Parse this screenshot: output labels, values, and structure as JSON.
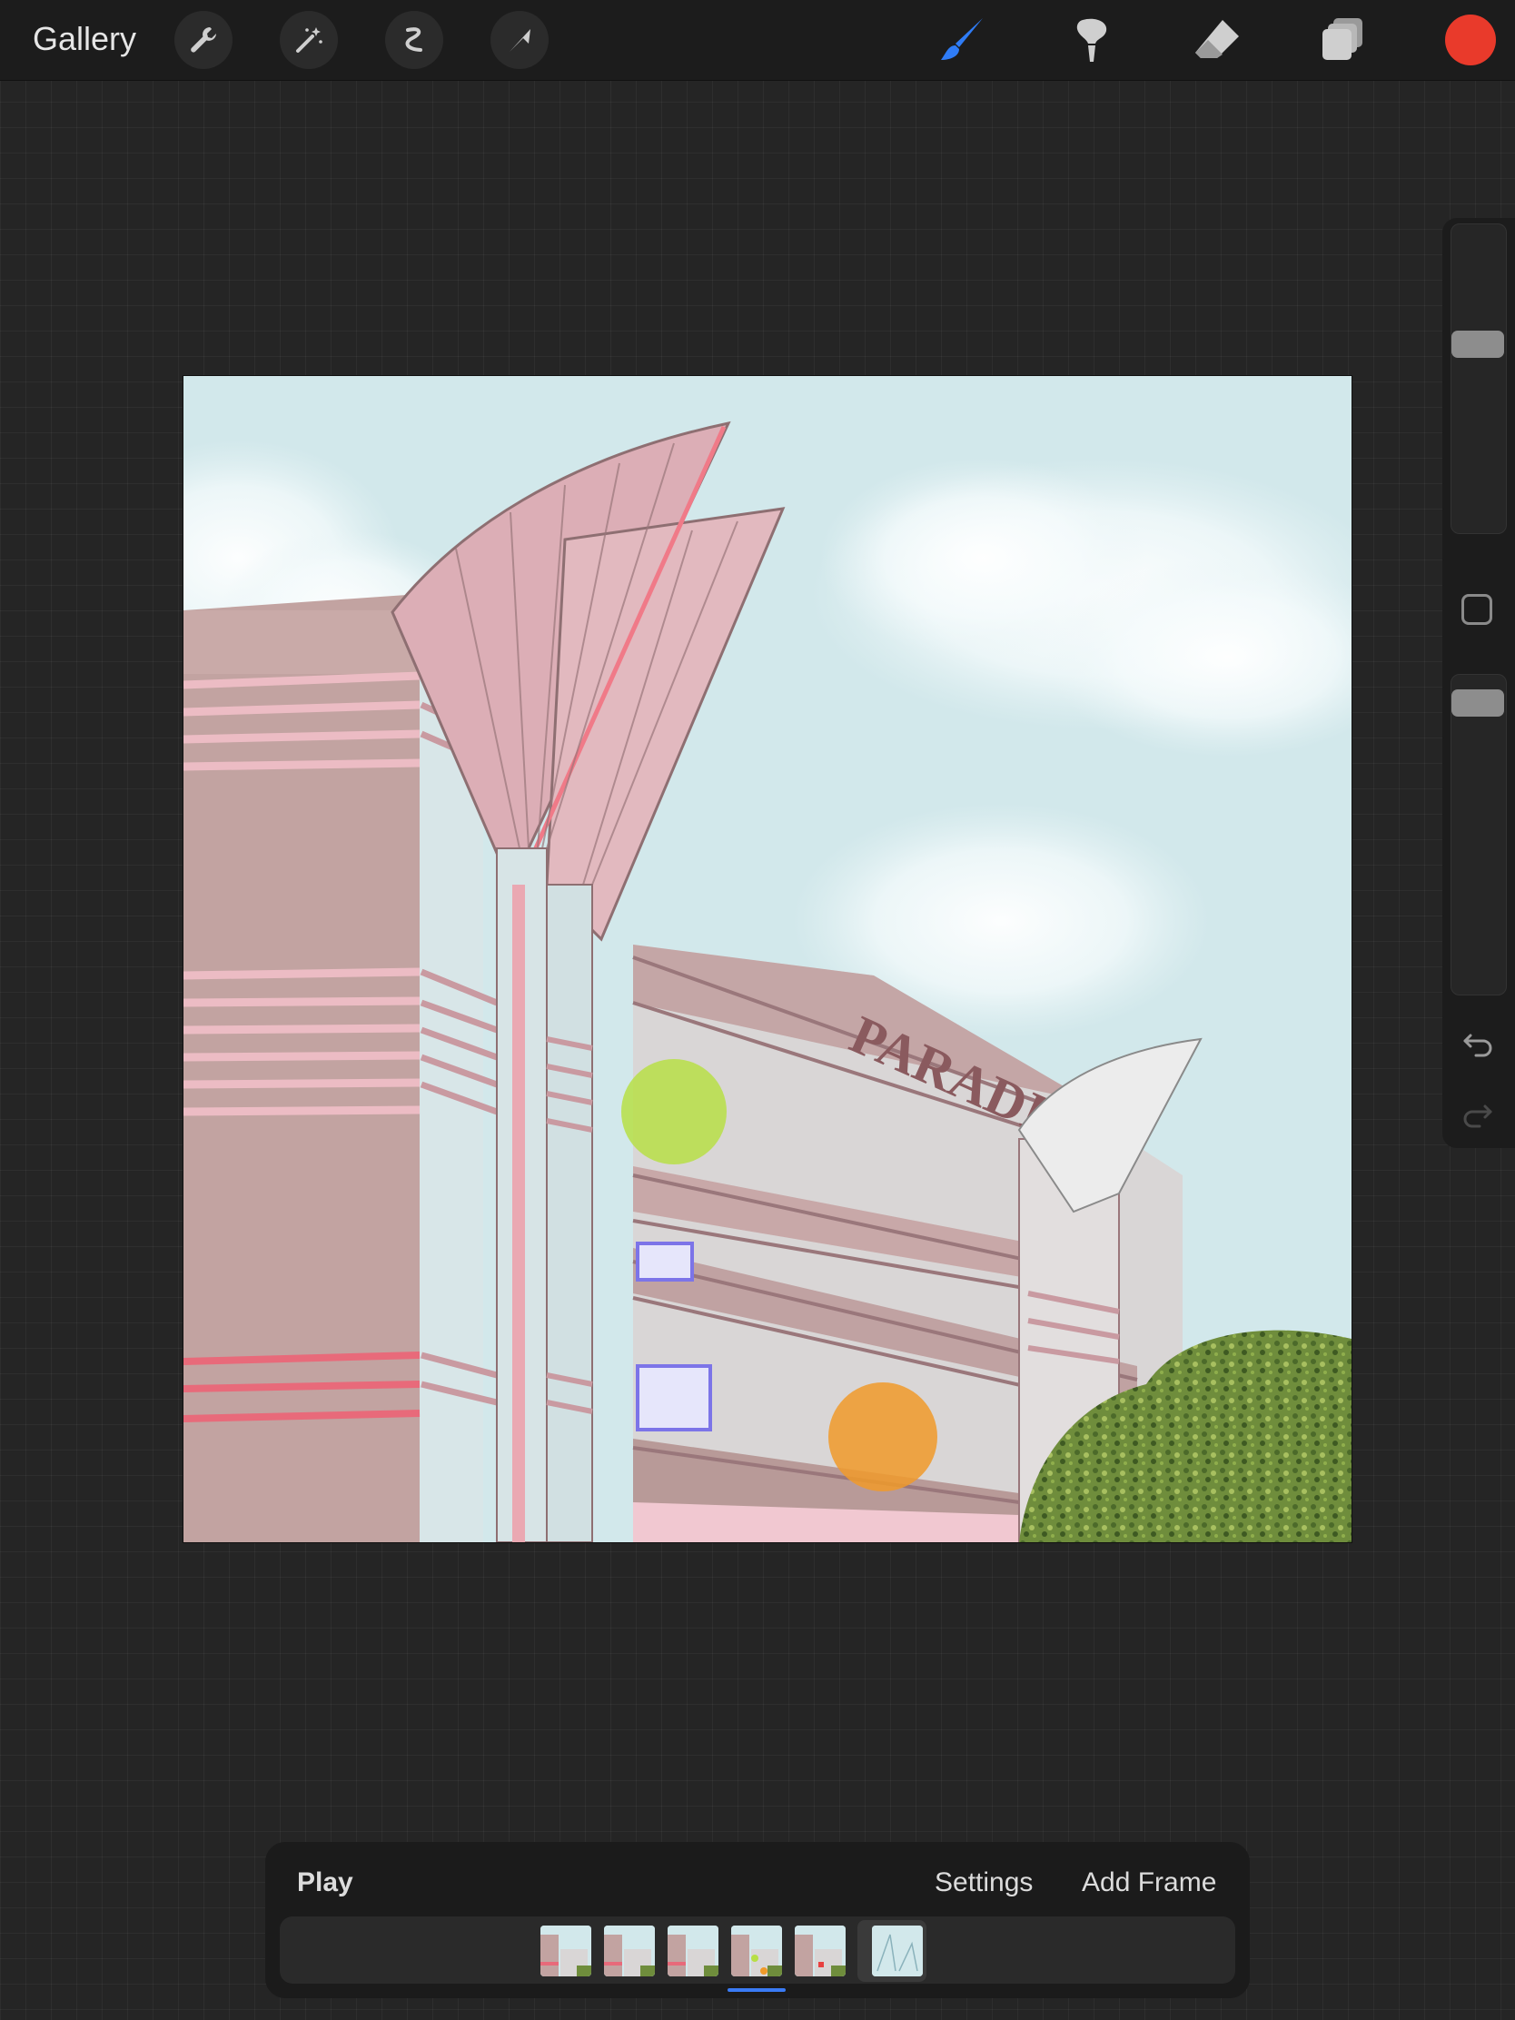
{
  "topbar": {
    "gallery_label": "Gallery",
    "left_tools": [
      "wrench-icon",
      "magic-wand-icon",
      "selection-icon",
      "transform-arrow-icon"
    ],
    "right_tools": [
      "brush-icon",
      "smudge-icon",
      "eraser-icon",
      "layers-icon"
    ],
    "active_tool": "brush-icon",
    "accent_color": "#2f7cf6",
    "current_color": "#e93a2b"
  },
  "sidebar": {
    "brush_size_level": 0.4,
    "opacity_level": 0.0,
    "undo_icon": "undo-icon",
    "redo_icon": "redo-icon"
  },
  "canvas": {
    "sign_text": "PARADISE"
  },
  "timeline": {
    "play_label": "Play",
    "settings_label": "Settings",
    "add_frame_label": "Add Frame",
    "frame_count": 6,
    "active_frame_index": 3
  }
}
